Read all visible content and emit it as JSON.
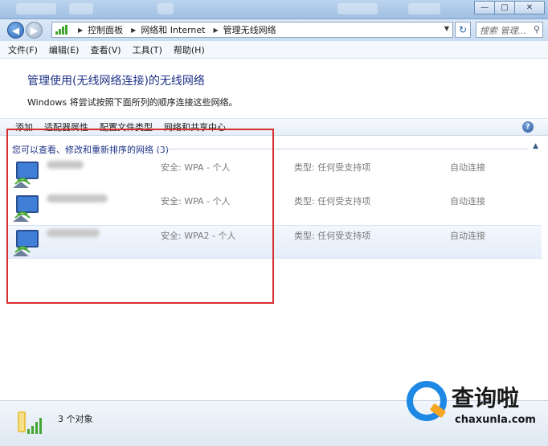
{
  "window": {
    "controls": {
      "minimize": "—",
      "maximize": "□",
      "close": "✕"
    }
  },
  "address": {
    "breadcrumbs": [
      "控制面板",
      "网络和 Internet",
      "管理无线网络"
    ],
    "separator": "▶",
    "dropdown": "▼",
    "refresh": "↻",
    "search_placeholder": "搜索 管理...",
    "search_icon": "🔍"
  },
  "menu": [
    "文件(F)",
    "编辑(E)",
    "查看(V)",
    "工具(T)",
    "帮助(H)"
  ],
  "header": {
    "title": "管理使用(无线网络连接)的无线网络",
    "description": "Windows 将尝试按照下面所列的顺序连接这些网络。"
  },
  "toolbar": {
    "items": [
      "添加",
      "适配器属性",
      "配置文件类型",
      "网络和共享中心"
    ],
    "help": "?"
  },
  "group": {
    "label": "您可以查看、修改和重新排序的网络 (3)",
    "collapse_icon": "chevron-up-icon"
  },
  "networks": [
    {
      "security": "安全: WPA - 个人",
      "type": "类型: 任何受支持项",
      "mode": "自动连接"
    },
    {
      "security": "安全: WPA - 个人",
      "type": "类型: 任何受支持项",
      "mode": "自动连接"
    },
    {
      "security": "安全: WPA2 - 个人",
      "type": "类型: 任何受支持项",
      "mode": "自动连接"
    }
  ],
  "status": {
    "count": "3 个对象"
  },
  "watermark": {
    "cn": "查询啦",
    "en": "chaxunla.com"
  },
  "colors": {
    "highlight": "#d62d2d",
    "accent": "#1e3287"
  }
}
